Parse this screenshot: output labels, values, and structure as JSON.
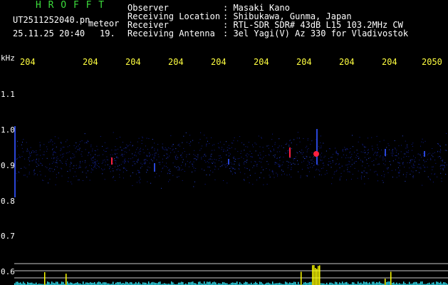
{
  "header": {
    "title": "H R O F F T",
    "filename": "UT2511252040.pn",
    "tag": "meteor",
    "datetime": "25.11.25 20:40",
    "minute": "19.",
    "fields": [
      {
        "label": "Observer",
        "value": ": Masaki Kano"
      },
      {
        "label": "Receiving Location",
        "value": ": Shibukawa, Gunma, Japan"
      },
      {
        "label": "Receiver",
        "value": ": RTL-SDR SDR# 43dB L15 103.2MHz CW"
      },
      {
        "label": "Receiving Antenna",
        "value": ": 3el Yagi(V) Az 330 for Vladivostok"
      }
    ]
  },
  "axis": {
    "y_unit": "kHz",
    "y_ticks": [
      "1.1",
      "1.0",
      "0.9",
      "0.8",
      "0.7",
      "0.6"
    ],
    "x_ticks": [
      "204",
      "204",
      "204",
      "204",
      "204",
      "204",
      "204",
      "204",
      "204",
      "2050"
    ]
  },
  "colors": {
    "background": "#000000",
    "label_text": "#ffffff",
    "tick_text": "#ffff40",
    "title_text": "#3cdc3c",
    "noise_low": "#101c8c",
    "noise_mid": "#2a46d8",
    "signal_hot": "#ff2040",
    "baseline": "#30e0f0",
    "peak": "#ffff00",
    "guide_line": "#c8c8c8"
  }
}
